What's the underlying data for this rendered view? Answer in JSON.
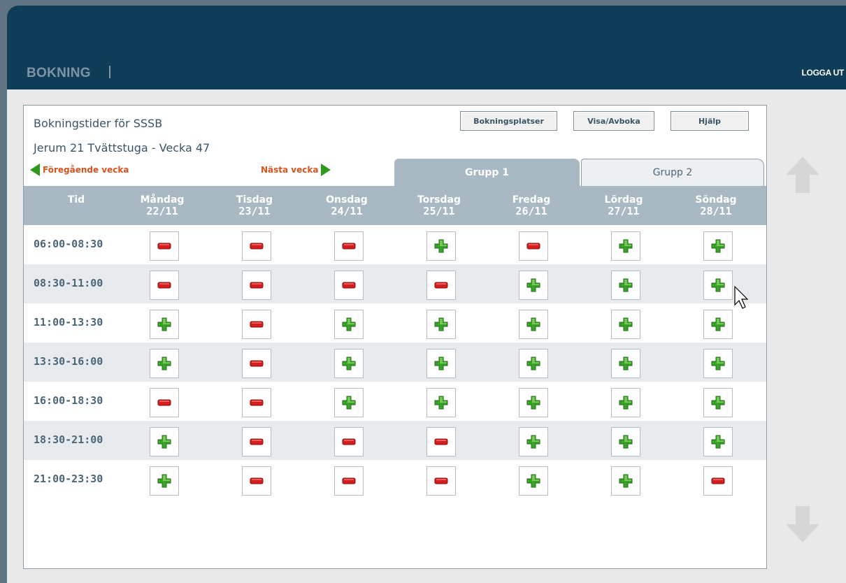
{
  "app": {
    "brand": "BOKNING",
    "logout_label": "LOGGA UT"
  },
  "panel": {
    "title": "Bokningstider för SSSB",
    "subtitle": "Jerum 21 Tvättstuga - Vecka 47",
    "buttons": [
      "Bokningsplatser",
      "Visa/Avboka",
      "Hjälp"
    ],
    "prev_week_label": "Föregående vecka",
    "next_week_label": "Nästa vecka",
    "tabs": [
      {
        "label": "Grupp 1",
        "active": true
      },
      {
        "label": "Grupp 2",
        "active": false
      }
    ]
  },
  "table": {
    "time_header": "Tid",
    "days": [
      {
        "day": "Måndag",
        "date": "22/11"
      },
      {
        "day": "Tisdag",
        "date": "23/11"
      },
      {
        "day": "Onsdag",
        "date": "24/11"
      },
      {
        "day": "Torsdag",
        "date": "25/11"
      },
      {
        "day": "Fredag",
        "date": "26/11"
      },
      {
        "day": "Lördag",
        "date": "27/11"
      },
      {
        "day": "Söndag",
        "date": "28/11"
      }
    ],
    "rows": [
      {
        "time": "06:00-08:30",
        "slots": [
          "booked",
          "booked",
          "booked",
          "available",
          "booked",
          "available",
          "available"
        ]
      },
      {
        "time": "08:30-11:00",
        "slots": [
          "booked",
          "booked",
          "booked",
          "booked",
          "available",
          "available",
          "available"
        ]
      },
      {
        "time": "11:00-13:30",
        "slots": [
          "available",
          "booked",
          "available",
          "available",
          "available",
          "available",
          "available"
        ]
      },
      {
        "time": "13:30-16:00",
        "slots": [
          "available",
          "booked",
          "available",
          "available",
          "available",
          "available",
          "available"
        ]
      },
      {
        "time": "16:00-18:30",
        "slots": [
          "booked",
          "booked",
          "available",
          "available",
          "available",
          "available",
          "available"
        ]
      },
      {
        "time": "18:30-21:00",
        "slots": [
          "available",
          "booked",
          "booked",
          "booked",
          "available",
          "available",
          "available"
        ]
      },
      {
        "time": "21:00-23:30",
        "slots": [
          "available",
          "booked",
          "booked",
          "booked",
          "available",
          "available",
          "booked"
        ]
      }
    ]
  },
  "icons": {
    "available": "plus-icon",
    "booked": "minus-icon",
    "scroll_up": "arrow-up-icon",
    "scroll_down": "arrow-down-icon"
  },
  "colors": {
    "header_bg": "#0f3d57",
    "table_header_bg": "#a9b9c4",
    "nav_text": "#d9531e",
    "available": "#3aa12a",
    "booked": "#d51b1b"
  }
}
